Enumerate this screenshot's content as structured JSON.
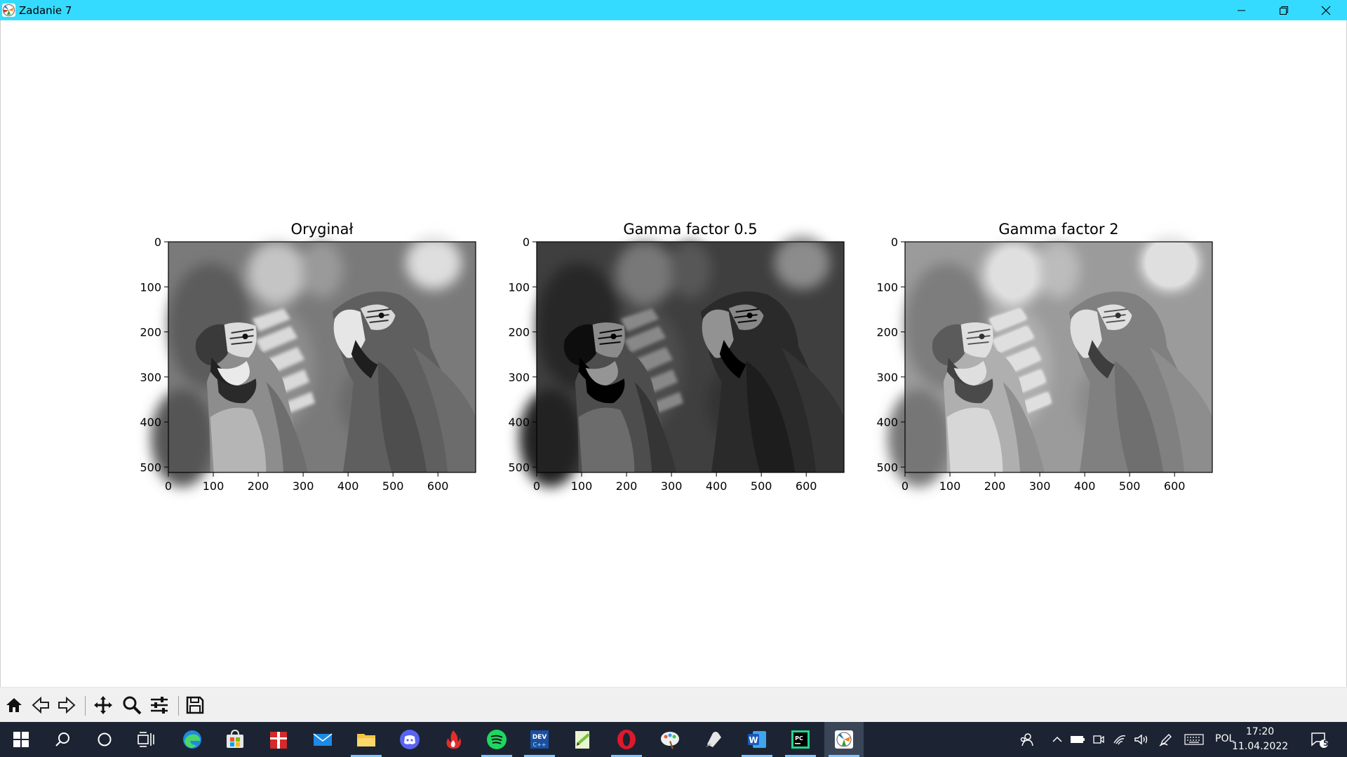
{
  "window": {
    "title": "Zadanie 7"
  },
  "figure": {
    "subplots": [
      {
        "title": "Oryginał",
        "shade": "mid"
      },
      {
        "title": "Gamma factor 0.5",
        "shade": "dark"
      },
      {
        "title": "Gamma factor 2",
        "shade": "light"
      }
    ],
    "y_ticks": [
      "0",
      "100",
      "200",
      "300",
      "400",
      "500"
    ],
    "x_ticks": [
      "0",
      "100",
      "200",
      "300",
      "400",
      "500",
      "600"
    ]
  },
  "toolbar": {
    "buttons": [
      "home-icon",
      "back-arrow-icon",
      "forward-arrow-icon",
      "pan-icon",
      "zoom-icon",
      "configure-subplots-icon",
      "save-icon"
    ]
  },
  "taskbar": {
    "apps": [
      "edge",
      "store",
      "gift",
      "mail",
      "file-explorer",
      "discord",
      "flame-app",
      "spotify",
      "dev-cpp",
      "notepad-plus",
      "opera",
      "paint",
      "inkscape",
      "word",
      "pycharm",
      "matplotlib-figure"
    ],
    "language": "POL",
    "time": "17:20",
    "date": "11.04.2022",
    "notification_count": "5"
  },
  "colors": {
    "titlebar": "#35dbff",
    "taskbar": "#1c2433",
    "toolbar": "#f0f0f0"
  }
}
